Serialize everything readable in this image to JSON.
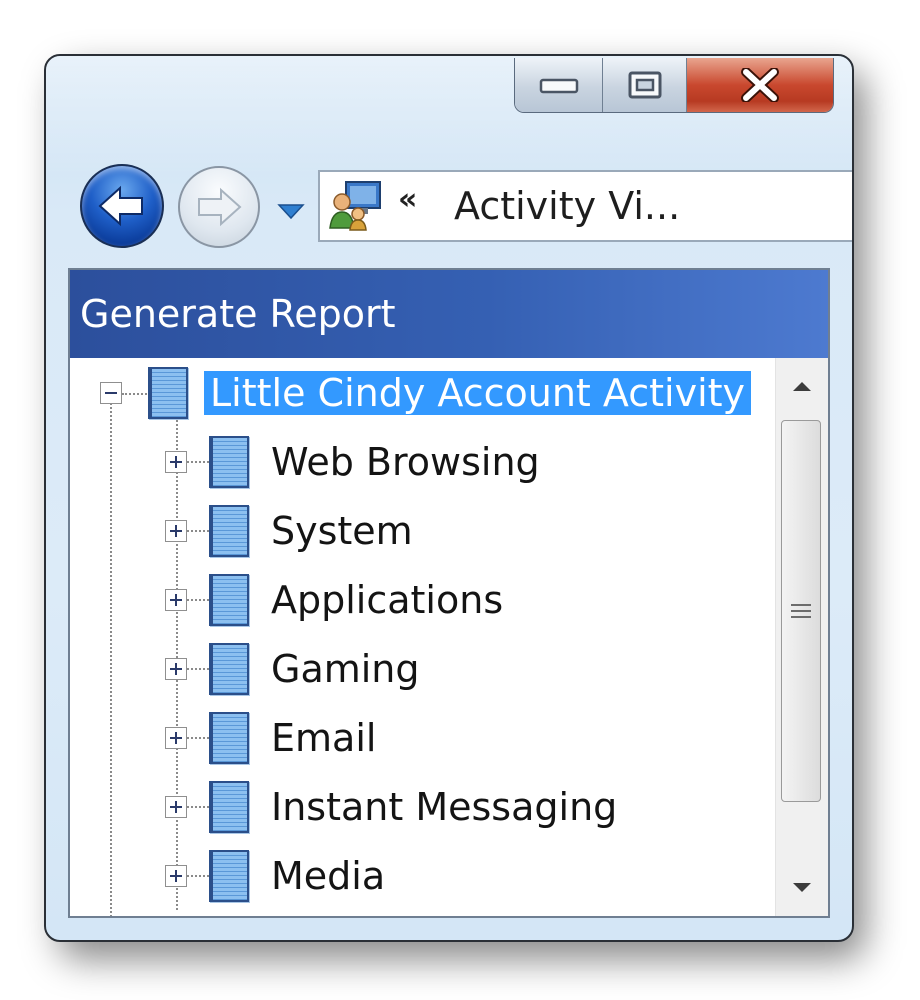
{
  "window": {
    "caption_buttons": [
      "minimize-icon",
      "maximize-icon",
      "close-icon"
    ]
  },
  "navigation": {
    "back_icon": "back-arrow-icon",
    "forward_icon": "forward-arrow-icon",
    "history_icon": "dropdown-arrow-icon",
    "address_icon": "parental-controls-icon",
    "address_chevron": "«",
    "address_text": "Activity Vi..."
  },
  "panel": {
    "header": "Generate Report"
  },
  "tree": {
    "root": {
      "label": "Little Cindy Account Activity",
      "expanded": true,
      "selected": true
    },
    "children": [
      {
        "label": "Web Browsing",
        "expanded": false
      },
      {
        "label": "System",
        "expanded": false
      },
      {
        "label": "Applications",
        "expanded": false
      },
      {
        "label": "Gaming",
        "expanded": false
      },
      {
        "label": "Email",
        "expanded": false
      },
      {
        "label": "Instant Messaging",
        "expanded": false
      },
      {
        "label": "Media",
        "expanded": false
      }
    ]
  },
  "scrollbar": {
    "position_fraction": 0.0
  },
  "colors": {
    "header_bg": "#3560b3",
    "selection_bg": "#3399ff",
    "close_button": "#c9482e"
  }
}
